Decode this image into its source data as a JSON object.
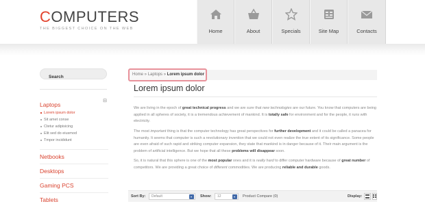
{
  "logo": {
    "first_letter": "C",
    "rest": "OMPUTERS",
    "tagline": "THE BIGGEST CHOICE ON THE WEB"
  },
  "nav": [
    {
      "label": "Home",
      "icon": "home-icon"
    },
    {
      "label": "About",
      "icon": "basket-icon"
    },
    {
      "label": "Specials",
      "icon": "star-icon"
    },
    {
      "label": "Site Map",
      "icon": "sitemap-icon"
    },
    {
      "label": "Contacts",
      "icon": "envelope-icon"
    }
  ],
  "sidebar": {
    "search_placeholder": "Search",
    "active_category": "Laptops",
    "collapse_symbol": "⊟",
    "sub_items": [
      "Lorem ipsum dolor",
      "Sit amet conse",
      "Ctetur adipisicing",
      "Elit sed do eiusmod",
      "Tmpor incididunt"
    ],
    "categories": [
      "Netbooks",
      "Desktops",
      "Gaming PCS",
      "Tablets"
    ]
  },
  "breadcrumb": {
    "home": "Home",
    "sep1": " » ",
    "section": "Laptops",
    "sep2": " » ",
    "current": "Lorem ipsum dolor"
  },
  "main": {
    "title": "Lorem ipsum dolor",
    "p1": {
      "a": "We are living in the epoch of ",
      "b1": "great technical progress",
      "c": " and we are sure that ",
      "i1": "new technologies",
      "d": " are our future. You know that computers are being applied in all spheres of society, it is a tremendous achievement of mankind. It is ",
      "b2": "totally safe",
      "e": " for environment and for the people, it runs with electricity."
    },
    "p2": {
      "a": "The most ",
      "i1": "important",
      "b": " thing is that the computer technology has great perspectives for ",
      "b1": "further development",
      "c": " and it could be called a panacea for humanity. It seems that computer is such a revolutionary invention that we could not even realize the true extent of its significance. Some people are even afraid of such rapid and striking computer expansion, they state that mankind is in danger because of it. Their main argument is the problem of artificial intelligence. But we hope that all these ",
      "b2": "problems will disappear",
      "d": " soon."
    },
    "p3": {
      "a": "So, it is natural that this sphere is one of the ",
      "b1": "most popular",
      "b": " ones and it is ",
      "i1": "really hard",
      "c": " to differ computer hardware because of ",
      "b2": "great number",
      "d": " of competitors. We are providing a great choice of ",
      "i2": "different",
      "e": " commodities. We are producing ",
      "b3": "reliable and durable",
      "f": " goods."
    }
  },
  "toolbar": {
    "sort_label": "Sort By:",
    "sort_value": "Default",
    "show_label": "Show:",
    "show_value": "12",
    "compare_text": "Product Compare (0)",
    "display_label": "Display:"
  }
}
